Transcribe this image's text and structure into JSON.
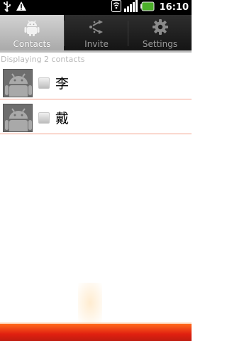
{
  "status_bar": {
    "time": "16:10",
    "left_icons": [
      "usb-icon",
      "warning-icon"
    ],
    "right_icons": [
      "wifi-icon",
      "signal-icon",
      "battery-icon"
    ],
    "battery_color": "#4caf2a"
  },
  "tabs": [
    {
      "label": "Contacts",
      "icon": "android-icon",
      "active": true
    },
    {
      "label": "Invite",
      "icon": "share-icon",
      "active": false
    },
    {
      "label": "Settings",
      "icon": "gear-icon",
      "active": false
    }
  ],
  "list": {
    "subheader": "Displaying 2 contacts",
    "contacts": [
      {
        "name": "李",
        "avatar": "android-avatar-icon",
        "presence": "offline"
      },
      {
        "name": "戴",
        "avatar": "android-avatar-icon",
        "presence": "offline"
      }
    ]
  },
  "colors": {
    "accent": "#f4a28c",
    "bottom_bar": "#e02010"
  }
}
